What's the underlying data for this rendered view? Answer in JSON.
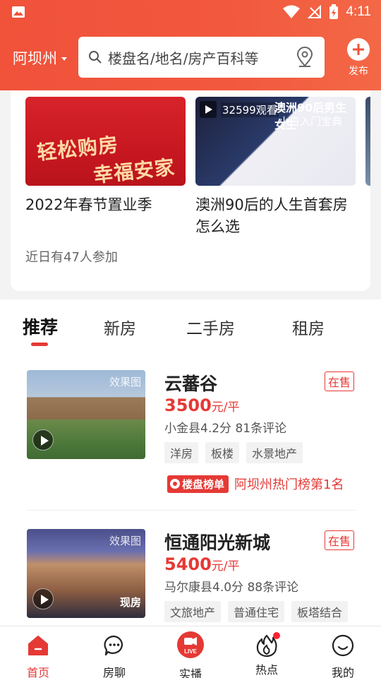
{
  "status_bar": {
    "time": "4:11"
  },
  "header": {
    "city": "阿坝州",
    "search_placeholder": "楼盘名/地名/房产百科等",
    "publish_label": "发布"
  },
  "activities": [
    {
      "title": "2022年春节置业季",
      "thumb_text": [
        "轻松购房",
        "幸福安家"
      ]
    },
    {
      "title": "澳洲90后的人生首套房怎么选",
      "views": "32599观看",
      "banner": "澳洲90后男生女生",
      "banner2": "小白入门宝典"
    }
  ],
  "activity_participants": "近日有47人参加",
  "tabs": [
    "推荐",
    "新房",
    "二手房",
    "租房"
  ],
  "listings": [
    {
      "name": "云蕃谷",
      "status": "在售",
      "price": "3500",
      "price_unit": "元/平",
      "meta": "小金县4.2分 81条评论",
      "tags": [
        "洋房",
        "板楼",
        "水景地产"
      ],
      "watermark": "效果图",
      "rank_badge": "楼盘榜单",
      "rank_text": "阿坝州热门榜第1名"
    },
    {
      "name": "恒通阳光新城",
      "status": "在售",
      "price": "5400",
      "price_unit": "元/平",
      "meta": "马尔康县4.0分 88条评论",
      "tags": [
        "文旅地产",
        "普通住宅",
        "板塔结合"
      ],
      "watermark": "效果图",
      "overlay": "现房"
    }
  ],
  "bottom_nav": [
    {
      "label": "首页",
      "icon": "home-icon"
    },
    {
      "label": "房聊",
      "icon": "chat-icon"
    },
    {
      "label": "实播",
      "icon": "live-icon",
      "badge": "LIVE"
    },
    {
      "label": "热点",
      "icon": "fire-icon"
    },
    {
      "label": "我的",
      "icon": "profile-icon"
    }
  ],
  "colors": {
    "accent": "#e53935",
    "header": "#f0523a"
  }
}
